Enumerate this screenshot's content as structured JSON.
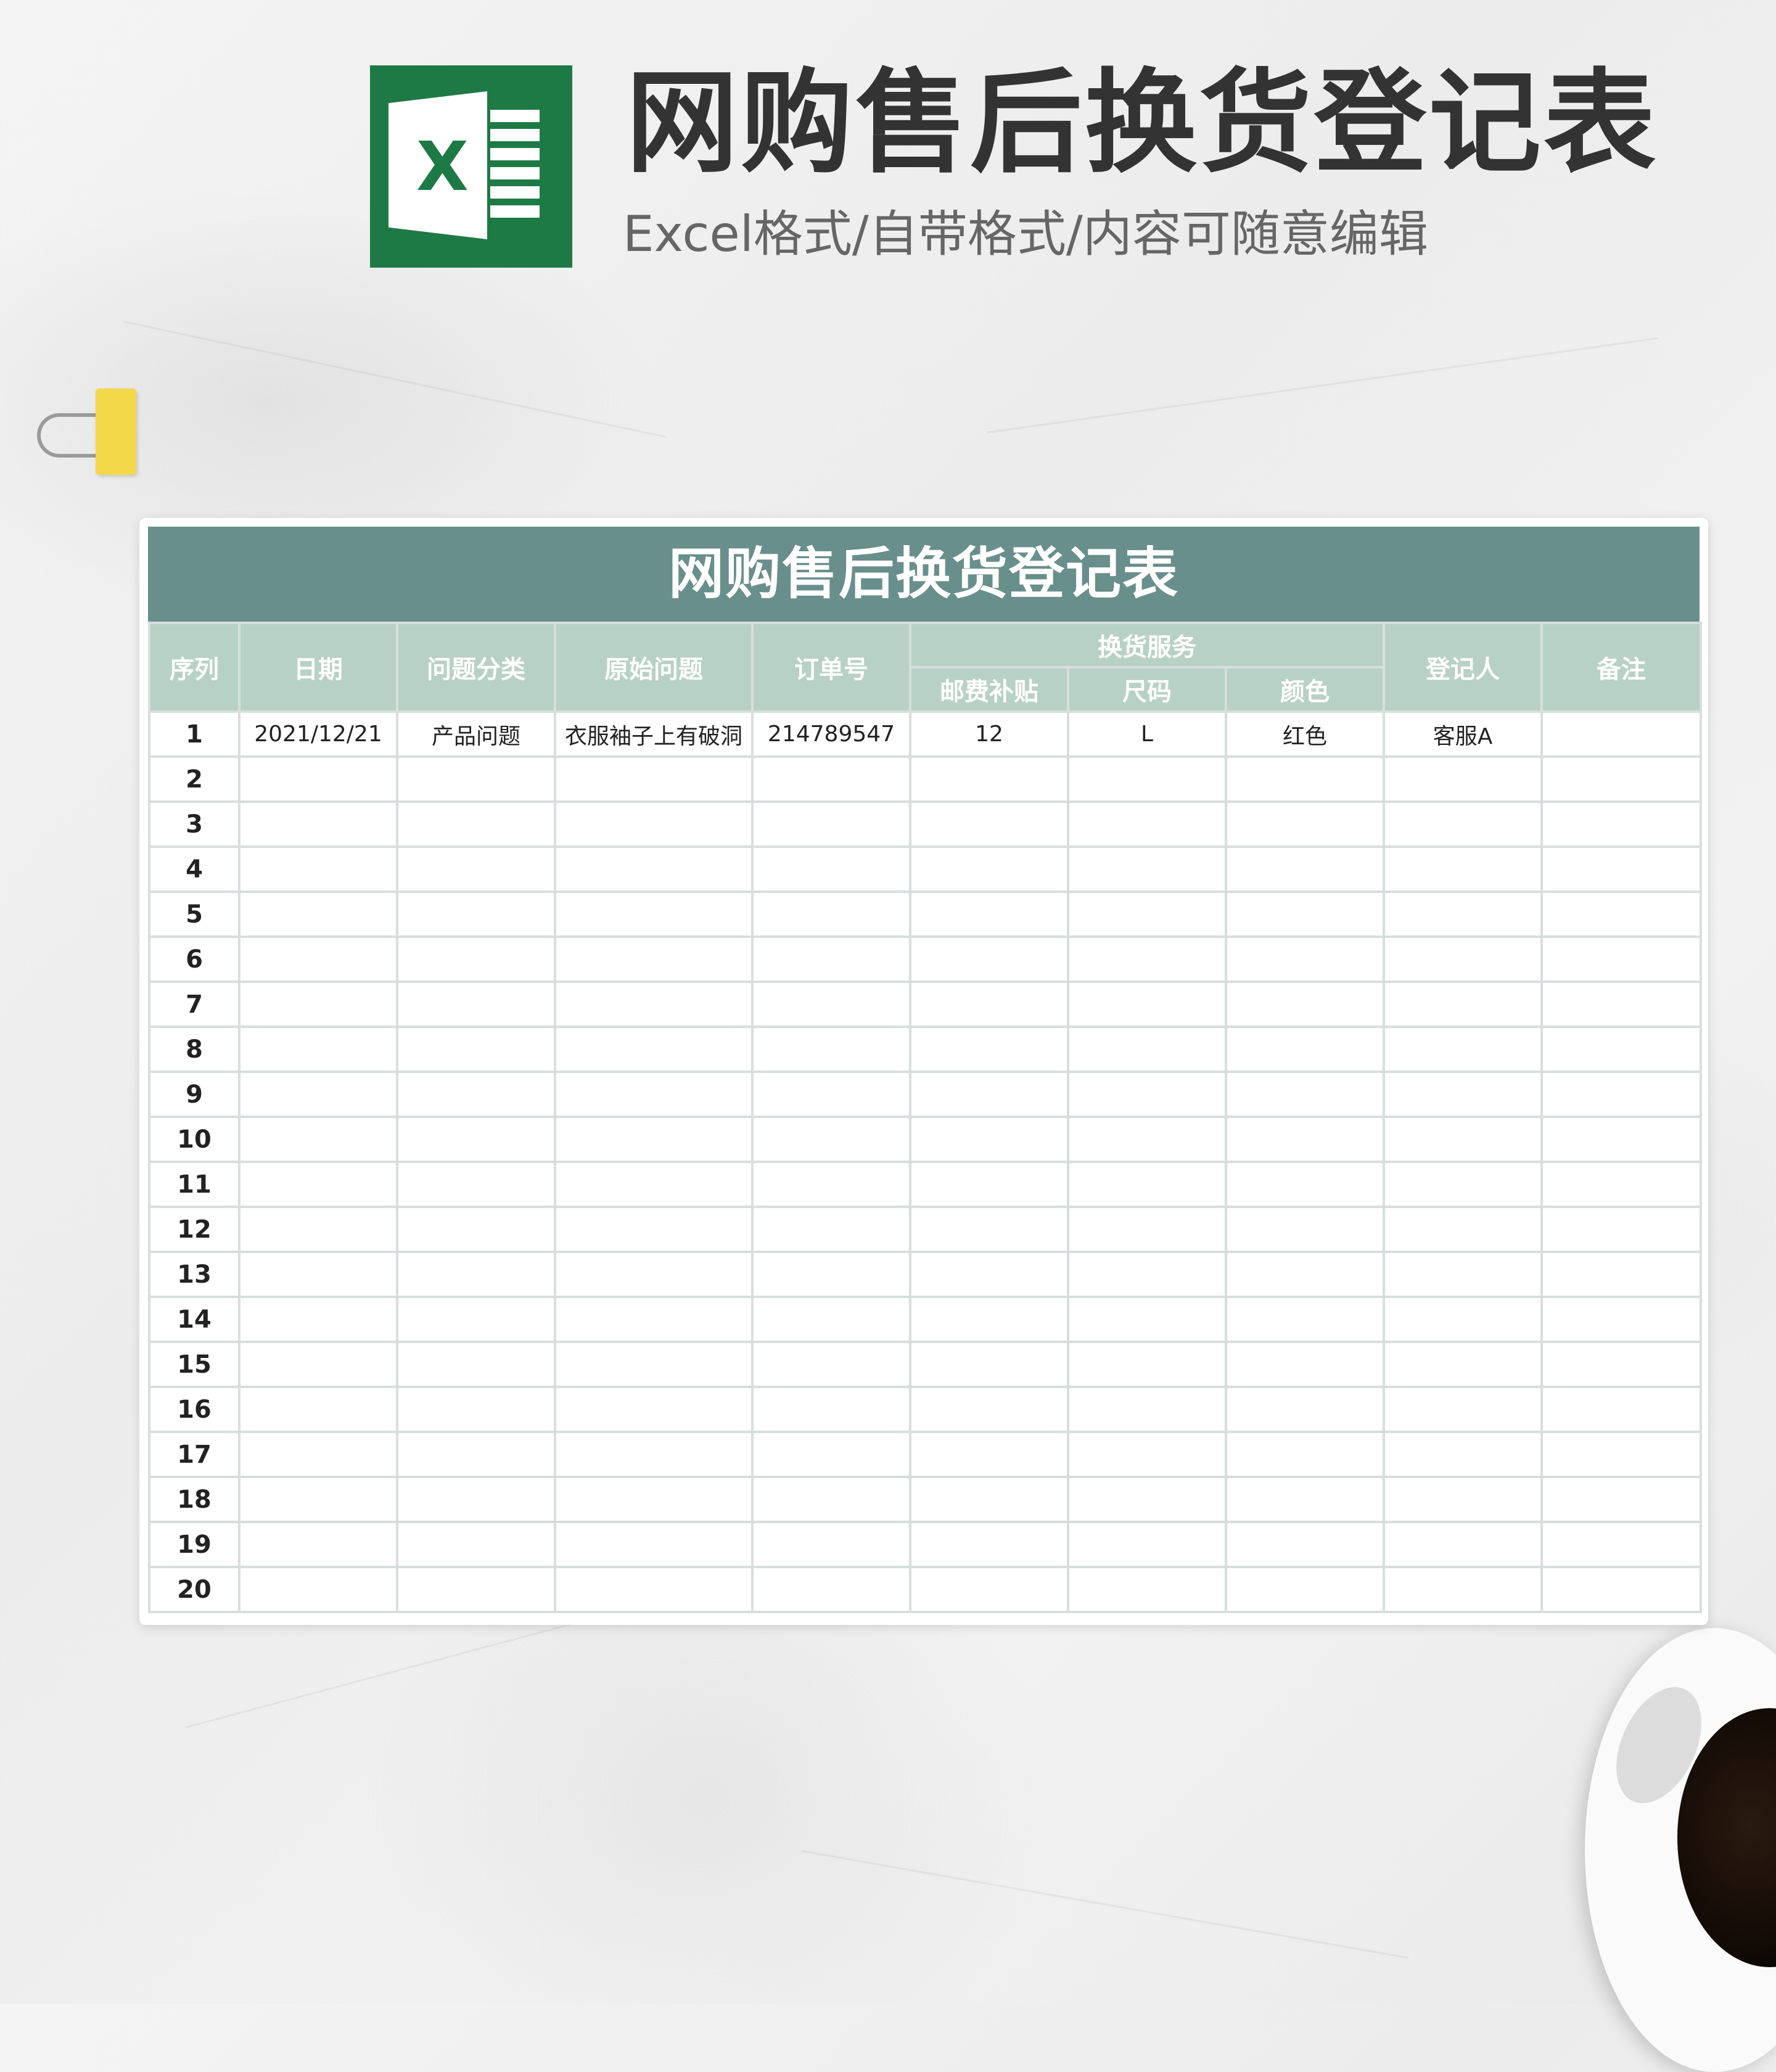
{
  "header": {
    "title": "网购售后换货登记表",
    "subtitle": "Excel格式/自带格式/内容可随意编辑",
    "logo_letter": "X"
  },
  "sheet": {
    "title": "网购售后换货登记表",
    "columns": {
      "seq": "序列",
      "date": "日期",
      "category": "问题分类",
      "original_issue": "原始问题",
      "order_no": "订单号",
      "exchange_service": "换货服务",
      "postage_subsidy": "邮费补贴",
      "size": "尺码",
      "color": "颜色",
      "registrar": "登记人",
      "remark": "备注"
    },
    "rows": [
      {
        "seq": "1",
        "date": "2021/12/21",
        "category": "产品问题",
        "original_issue": "衣服袖子上有破洞",
        "order_no": "214789547",
        "postage_subsidy": "12",
        "size": "L",
        "color": "红色",
        "registrar": "客服A",
        "remark": ""
      },
      {
        "seq": "2"
      },
      {
        "seq": "3"
      },
      {
        "seq": "4"
      },
      {
        "seq": "5"
      },
      {
        "seq": "6"
      },
      {
        "seq": "7"
      },
      {
        "seq": "8"
      },
      {
        "seq": "9"
      },
      {
        "seq": "10"
      },
      {
        "seq": "11"
      },
      {
        "seq": "12"
      },
      {
        "seq": "13"
      },
      {
        "seq": "14"
      },
      {
        "seq": "15"
      },
      {
        "seq": "16"
      },
      {
        "seq": "17"
      },
      {
        "seq": "18"
      },
      {
        "seq": "19"
      },
      {
        "seq": "20"
      }
    ]
  },
  "colors": {
    "banner": "#698f8c",
    "header_cells": "#b8d1c6",
    "excel_green": "#1e7a45"
  }
}
